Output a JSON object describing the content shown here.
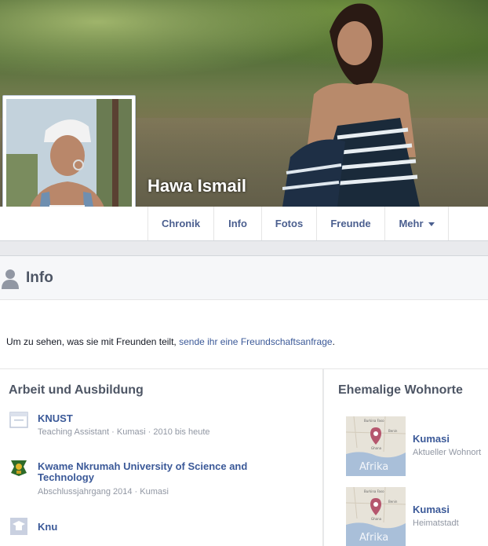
{
  "profile": {
    "name": "Hawa Ismail"
  },
  "tabs": [
    {
      "label": "Chronik"
    },
    {
      "label": "Info"
    },
    {
      "label": "Fotos"
    },
    {
      "label": "Freunde"
    },
    {
      "label": "Mehr"
    }
  ],
  "info": {
    "title": "Info"
  },
  "notice": {
    "text": "Um zu sehen, was sie mit Freunden teilt, ",
    "link": "sende ihr eine Freundschaftsanfrage",
    "end": "."
  },
  "work": {
    "title": "Arbeit und Ausbildung",
    "items": [
      {
        "name": "KNUST",
        "meta": "Teaching Assistant · Kumasi · 2010 bis heute",
        "icon": "briefcase-icon"
      },
      {
        "name": "Kwame Nkrumah University of Science and Technology",
        "meta": "Abschlussjahrgang 2014 · Kumasi",
        "icon": "university-crest-icon"
      },
      {
        "name": "Knu",
        "meta": "",
        "icon": "graduation-cap-icon"
      }
    ]
  },
  "places": {
    "title": "Ehemalige Wohnorte",
    "items": [
      {
        "name": "Kumasi",
        "sub": "Aktueller Wohnort",
        "map_label": "Afrika",
        "map_tags": [
          "Burkina Faso",
          "Benin",
          "Ghana"
        ]
      },
      {
        "name": "Kumasi",
        "sub": "Heimatstadt",
        "map_label": "Afrika",
        "map_tags": [
          "Burkina Faso",
          "Benin",
          "Ghana"
        ]
      }
    ]
  },
  "colors": {
    "link": "#3b5998",
    "muted": "#9197a3",
    "heading": "#4e5665"
  }
}
